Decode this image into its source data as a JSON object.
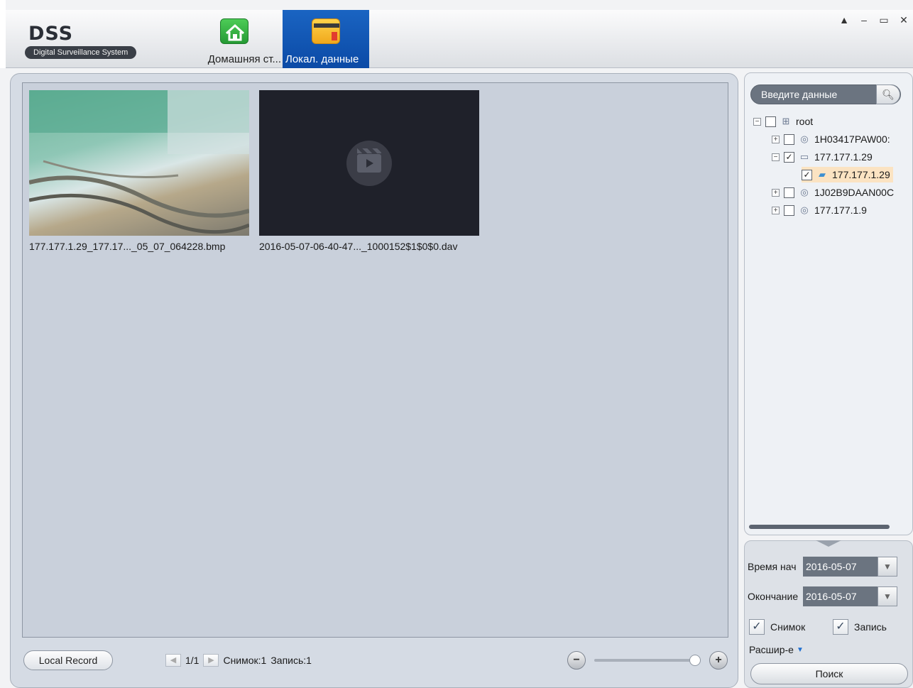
{
  "app": {
    "title": "DSS",
    "subtitle": "Digital Surveillance System"
  },
  "nav": {
    "tabs": [
      {
        "label": "Домашняя ст...",
        "icon": "home-icon"
      },
      {
        "label": "Локал. данные",
        "icon": "folder-icon",
        "active": true
      }
    ]
  },
  "window_controls": {
    "lock": "▲",
    "minimize": "–",
    "maximize": "▭",
    "close": "✕"
  },
  "gallery": {
    "files": [
      {
        "name": "177.177.1.29_177.17..._05_07_064228.bmp",
        "type": "snapshot"
      },
      {
        "name": "2016-05-07-06-40-47..._1000152$1$0$0.dav",
        "type": "record"
      }
    ]
  },
  "footer": {
    "local_record_label": "Local Record",
    "page": "1/1",
    "snapshot_count": "Снимок:1",
    "record_count": "Запись:1",
    "zoom_minus": "−",
    "zoom_plus": "+"
  },
  "sidebar": {
    "search_placeholder": "Введите данные",
    "tree": [
      {
        "label": "root",
        "level": 0,
        "expander": "−",
        "checked": false,
        "icon": "network-icon"
      },
      {
        "label": "1H03417PAW00:",
        "level": 1,
        "expander": "+",
        "checked": false,
        "icon": "camera-icon"
      },
      {
        "label": "177.177.1.29",
        "level": 1,
        "expander": "−",
        "checked": true,
        "icon": "dvr-icon"
      },
      {
        "label": "177.177.1.29",
        "level": 2,
        "expander": "",
        "checked": true,
        "icon": "channel-icon",
        "selected": true
      },
      {
        "label": "1J02B9DAAN00C",
        "level": 1,
        "expander": "+",
        "checked": false,
        "icon": "camera-icon"
      },
      {
        "label": "177.177.1.9",
        "level": 1,
        "expander": "+",
        "checked": false,
        "icon": "camera-icon"
      }
    ]
  },
  "filters": {
    "start_label": "Время нач",
    "start_value": "2016-05-07",
    "end_label": "Окончание",
    "end_value": "2016-05-07",
    "snapshot_label": "Снимок",
    "record_label": "Запись",
    "advanced_label": "Расшир-е",
    "search_button": "Поиск"
  }
}
